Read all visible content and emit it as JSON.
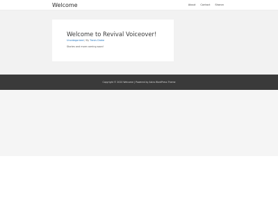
{
  "header": {
    "site_title": "Welcome",
    "nav": [
      "About",
      "Contact",
      "Sharon"
    ]
  },
  "post": {
    "title": "Welcome to Revival Voiceover!",
    "category": "Uncategorized",
    "meta_sep": " / By ",
    "author": "Travis Drake",
    "excerpt": "Stories and more coming soon!"
  },
  "footer": {
    "copyright": "Copyright © 2020 Welcome | Powered by Astra WordPress Theme"
  }
}
